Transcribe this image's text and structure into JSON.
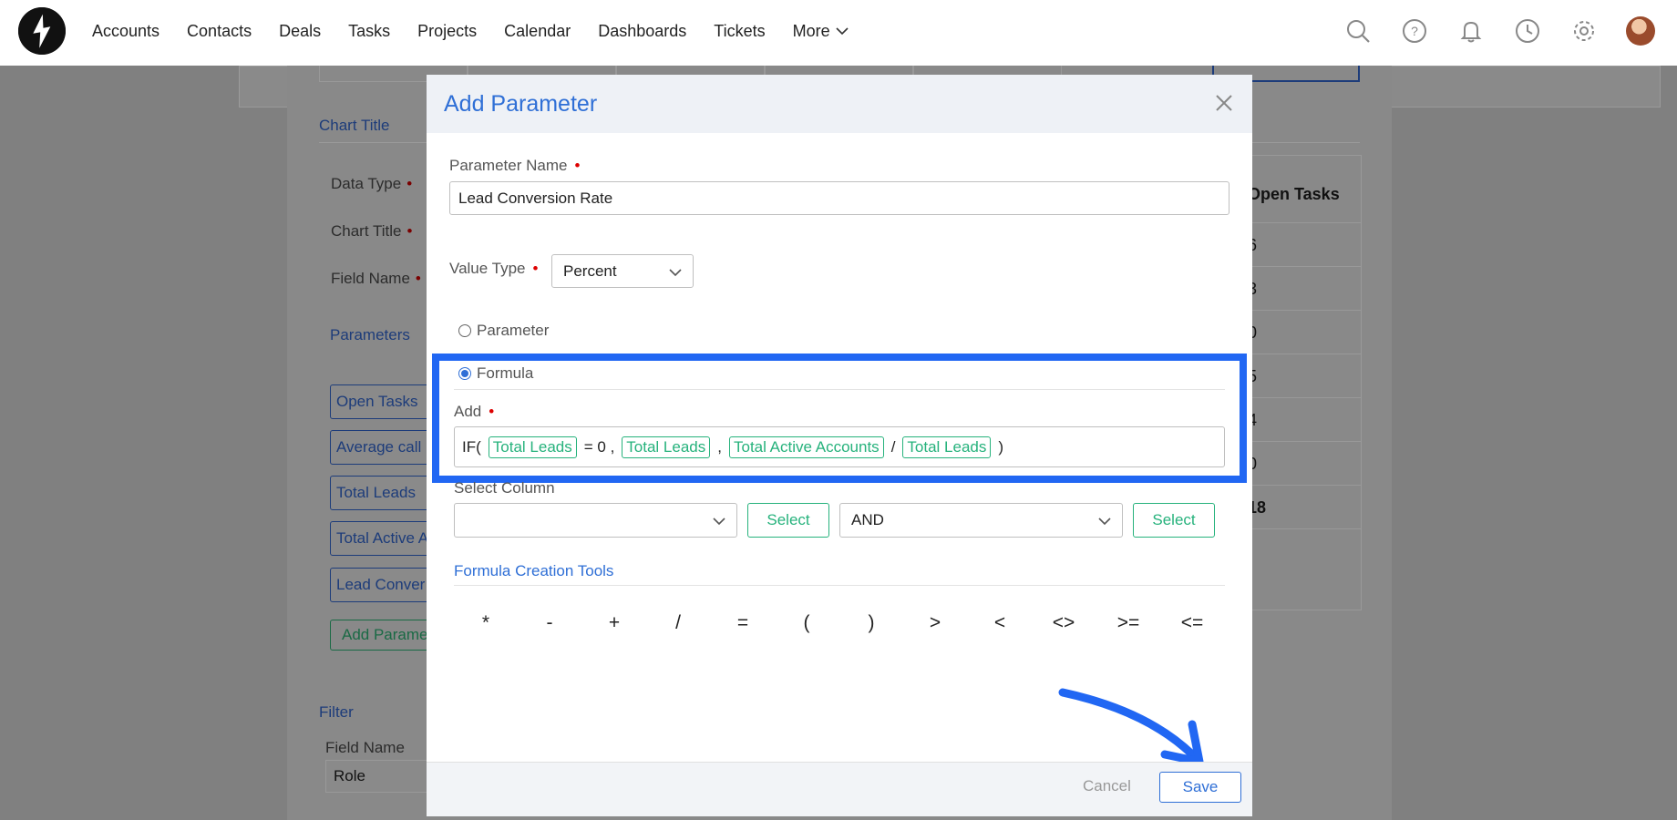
{
  "nav": {
    "items": [
      "Accounts",
      "Contacts",
      "Deals",
      "Tasks",
      "Projects",
      "Calendar",
      "Dashboards",
      "Tickets"
    ],
    "more_label": "More",
    "icons": [
      "search-icon",
      "help-icon",
      "bell-icon",
      "clock-icon",
      "gear-icon"
    ]
  },
  "background": {
    "chart_title_section": "Chart Title",
    "data_type_label": "Data Type",
    "chart_title_label": "Chart Title",
    "field_name_label": "Field Name",
    "parameters_section": "Parameters",
    "parameter_chips": [
      "Open Tasks",
      "Average call",
      "Total Leads",
      "Total Active A",
      "Lead Conver"
    ],
    "add_parameter_label": "Add Parame",
    "filter_section": "Filter",
    "filter_field_label": "Field Name",
    "filter_field_value": "Role",
    "table_header": "Open Tasks",
    "table_values": [
      "6",
      "3",
      "0",
      "5",
      "4",
      "0",
      "18"
    ]
  },
  "modal": {
    "title": "Add Parameter",
    "parameter_name_label": "Parameter Name",
    "parameter_name_value": "Lead Conversion Rate",
    "value_type_label": "Value Type",
    "value_type_value": "Percent",
    "radio_parameter": "Parameter",
    "radio_formula": "Formula",
    "add_label": "Add",
    "formula": {
      "t1": "IF(",
      "c1": "Total Leads",
      "t2": "= 0 ,",
      "c2": "Total Leads",
      "t3": ",",
      "c3": "Total Active Accounts",
      "t4": "/",
      "c4": "Total Leads",
      "t5": ")"
    },
    "select_column_label": "Select Column",
    "select_column_value": "",
    "select_button": "Select",
    "logic_value": "AND",
    "select_button_2": "Select",
    "tools_label": "Formula Creation Tools",
    "operators": [
      "*",
      "-",
      "+",
      "/",
      "=",
      "(",
      ")",
      ">",
      "<",
      "<>",
      ">=",
      "<="
    ],
    "cancel_label": "Cancel",
    "save_label": "Save"
  },
  "colors": {
    "accent_blue": "#2f6fd6",
    "highlight_blue": "#2167f3",
    "chip_green": "#26b27c",
    "required_red": "#dd0000"
  }
}
